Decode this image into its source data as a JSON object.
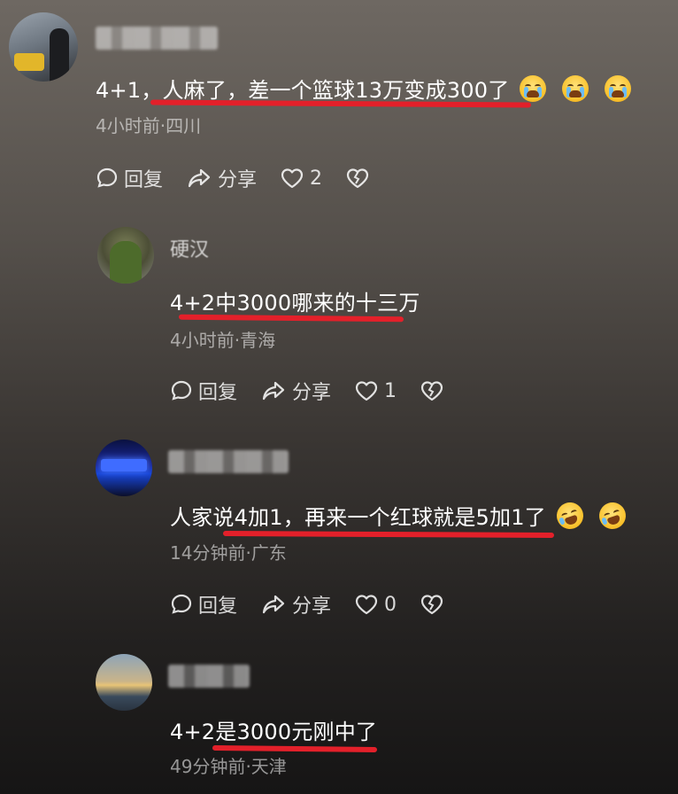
{
  "comments": [
    {
      "text": "4+1，人麻了，差一个篮球13万变成300了",
      "emojis": [
        "cry",
        "cry",
        "cry"
      ],
      "meta": "4小时前·四川",
      "reply_label": "回复",
      "share_label": "分享",
      "like_count": "2"
    },
    {
      "username_partial": "硬汉",
      "text": "4+2中3000哪来的十三万",
      "meta": "4小时前·青海",
      "reply_label": "回复",
      "share_label": "分享",
      "like_count": "1"
    },
    {
      "text": "人家说4加1，再来一个红球就是5加1了",
      "emojis": [
        "laugh",
        "laugh"
      ],
      "meta": "14分钟前·广东",
      "reply_label": "回复",
      "share_label": "分享",
      "like_count": "0"
    },
    {
      "text": "4+2是3000元刚中了",
      "meta": "49分钟前·天津"
    }
  ],
  "colors": {
    "underline": "#e3202a",
    "meta_text": "rgba(255,255,255,0.55)"
  },
  "icons": [
    "comment-bubble-icon",
    "share-arrow-icon",
    "heart-icon",
    "broken-heart-icon"
  ]
}
